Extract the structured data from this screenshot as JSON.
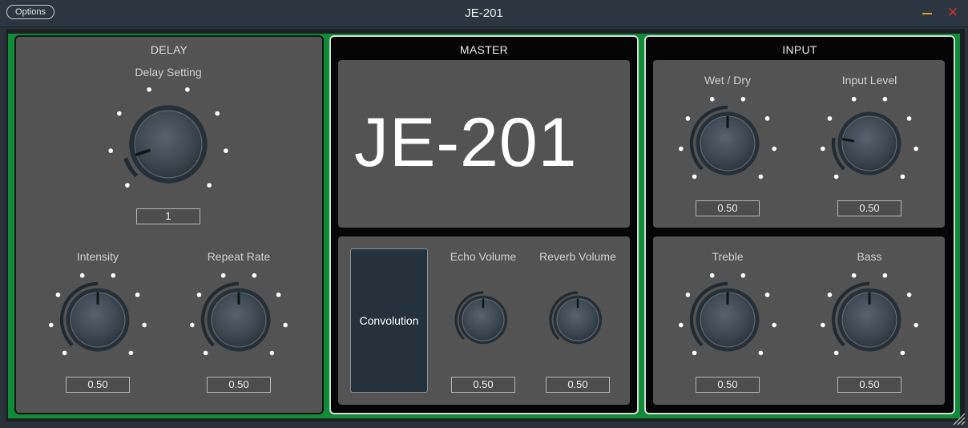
{
  "window": {
    "title": "JE-201",
    "options_label": "Options",
    "minimize_icon": "minimize-icon",
    "close_icon": "close-icon",
    "close_glyph": "✕"
  },
  "colors": {
    "frame_green": "#0f8a37",
    "panel_gray": "#535353",
    "knob_arc": "#222a31",
    "dot": "#ffffff",
    "minimize": "#e0a030",
    "close": "#d03030"
  },
  "delay": {
    "title": "DELAY",
    "delay_setting": {
      "label": "Delay Setting",
      "value": "1",
      "level": 0.1
    },
    "intensity": {
      "label": "Intensity",
      "value": "0.50",
      "level": 0.5
    },
    "repeat_rate": {
      "label": "Repeat Rate",
      "value": "0.50",
      "level": 0.5
    }
  },
  "master": {
    "title": "MASTER",
    "display_text": "JE-201",
    "convolution_label": "Convolution",
    "echo_volume": {
      "label": "Echo Volume",
      "value": "0.50",
      "level": 0.5
    },
    "reverb_volume": {
      "label": "Reverb Volume",
      "value": "0.50",
      "level": 0.5
    }
  },
  "input": {
    "title": "INPUT",
    "wet_dry": {
      "label": "Wet / Dry",
      "value": "0.50",
      "level": 0.5
    },
    "input_level": {
      "label": "Input Level",
      "value": "0.50",
      "level": 0.2
    },
    "treble": {
      "label": "Treble",
      "value": "0.50",
      "level": 0.5
    },
    "bass": {
      "label": "Bass",
      "value": "0.50",
      "level": 0.5
    }
  }
}
